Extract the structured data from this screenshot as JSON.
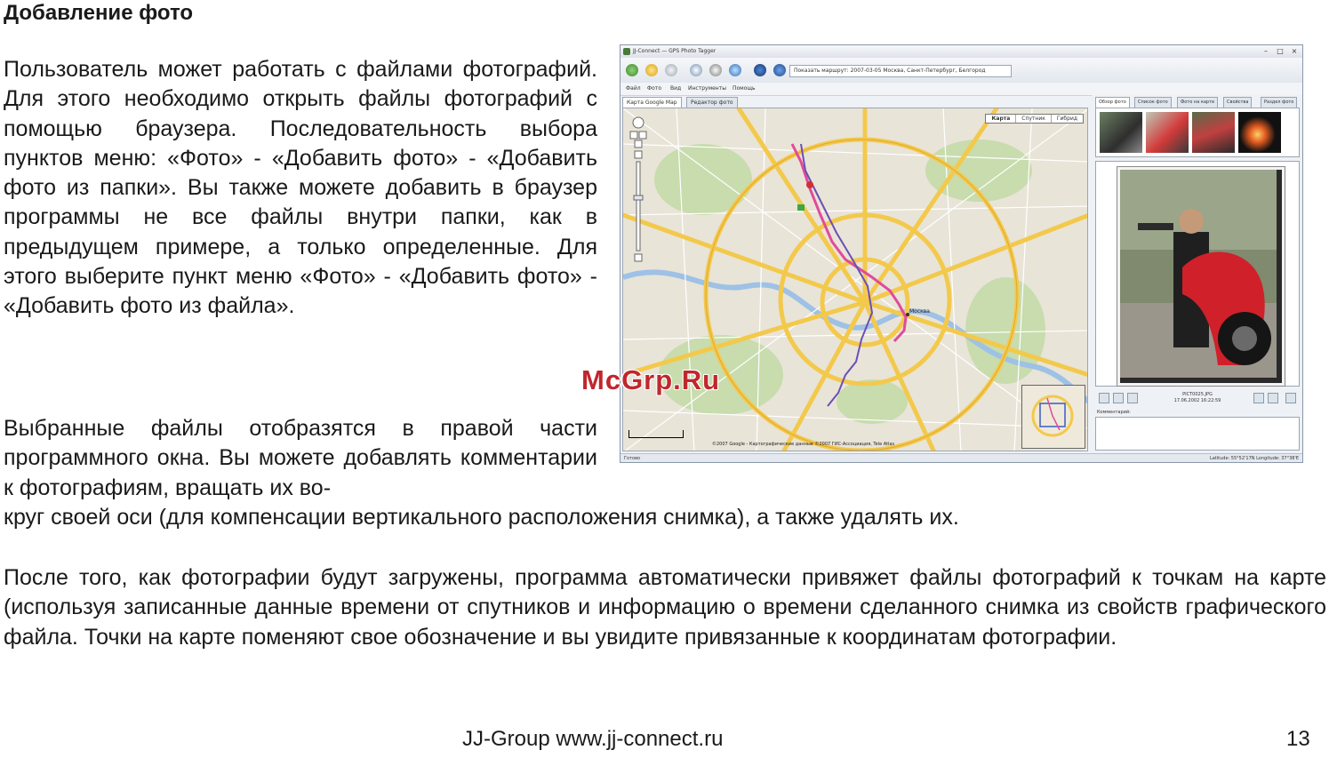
{
  "heading": "Добавление фото",
  "paragraph1": "Пользователь может работать с файлами фотографий. Для этого необходимо открыть файлы фотографий с помощью браузера. Последовательность выбора пунктов меню: «Фото» - «Добавить фото» - «Добавить фото из папки». Вы также можете добавить в браузер программы не все файлы внутри папки, как в предыдущем примере, а только определенные. Для этого выберите пункт меню «Фото» - «Добавить фото» - «Добавить фото из файла».",
  "paragraph2_start": "Выбранные файлы отобразятся в правой части программного окна. Вы можете добавлять комментарии к фотографиям, вращать их во-",
  "paragraph2_end": "круг своей оси (для компенсации вертикального расположения снимка), а также удалять их.",
  "paragraph3": "После того, как фотографии будут загружены, программа автоматически привяжет файлы фотографий к точкам на карте (используя записанные данные времени от спутников и информацию о времени сделанного снимка из свойств графического файла. Точки на карте поменяют свое обозначение и вы увидите привязанные к координатам фотографии.",
  "watermark": "McGrp.Ru",
  "footer": {
    "site": "JJ-Group www.jj-connect.ru",
    "page": "13"
  },
  "screenshot": {
    "window_title": "JJ-Connect — GPS Photo Tagger",
    "path_value": "Показать маршрут: 2007-03-05 Москва, Санкт-Петербург, Белгород",
    "menu": [
      "Файл",
      "Фото",
      "Вид",
      "Инструменты",
      "Помощь"
    ],
    "map_tabs": [
      "Карта Google Map",
      "Редактор фото"
    ],
    "map_types": [
      "Карта",
      "Спутник",
      "Гибрид"
    ],
    "map_city_label": "Москва",
    "map_copyright": "©2007 Google - Картографические данные ©2007 ГИС-Ассоциация, Tele Atlas",
    "photo_tabs": [
      "Обзор фото",
      "Список фото",
      "Фото на карте",
      "Свойства",
      "Раздел фото"
    ],
    "photo_filename": "PICT0025.JPG",
    "photo_date": "17.06.2002 16:22:59",
    "comment_label": "Комментарий:",
    "status_left": "Готово",
    "status_right": "Latitude: 55°52'17N Longitude: 37°38'E"
  },
  "colors": {
    "map_road_major": "#f3c94c",
    "map_road_minor": "#ffffff",
    "map_park": "#c8dcae",
    "map_water": "#9ec1e6",
    "track_pink": "#e04b9a",
    "track_purple": "#6a4fb5"
  }
}
